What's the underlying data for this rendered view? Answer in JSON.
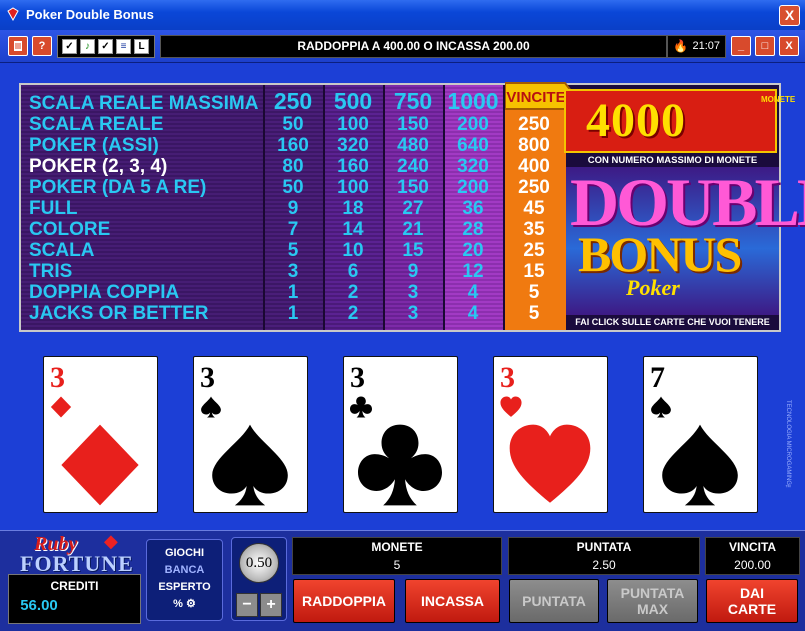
{
  "window": {
    "title": "Poker Double Bonus",
    "close_label": "X"
  },
  "toolbar": {
    "message": "RADDOPPIA A 400.00 O INCASSA 200.00",
    "time": "21:07",
    "help_label": "?",
    "mini_last": "L",
    "minimize": "_",
    "maximize": "□",
    "close": "X"
  },
  "paytable": {
    "vincite_label": "VINCITE",
    "rows": [
      {
        "hand": "SCALA REALE MASSIMA",
        "v": [
          "250",
          "500",
          "750",
          "1000"
        ],
        "win": ""
      },
      {
        "hand": "SCALA REALE",
        "v": [
          "50",
          "100",
          "150",
          "200"
        ],
        "win": "250"
      },
      {
        "hand": "POKER (ASSI)",
        "v": [
          "160",
          "320",
          "480",
          "640"
        ],
        "win": "800"
      },
      {
        "hand": "POKER (2, 3, 4)",
        "v": [
          "80",
          "160",
          "240",
          "320"
        ],
        "win": "400"
      },
      {
        "hand": "POKER (DA 5 A RE)",
        "v": [
          "50",
          "100",
          "150",
          "200"
        ],
        "win": "250"
      },
      {
        "hand": "FULL",
        "v": [
          "9",
          "18",
          "27",
          "36"
        ],
        "win": "45"
      },
      {
        "hand": "COLORE",
        "v": [
          "7",
          "14",
          "21",
          "28"
        ],
        "win": "35"
      },
      {
        "hand": "SCALA",
        "v": [
          "5",
          "10",
          "15",
          "20"
        ],
        "win": "25"
      },
      {
        "hand": "TRIS",
        "v": [
          "3",
          "6",
          "9",
          "12"
        ],
        "win": "15"
      },
      {
        "hand": "DOPPIA COPPIA",
        "v": [
          "1",
          "2",
          "3",
          "4"
        ],
        "win": "5"
      },
      {
        "hand": "JACKS OR BETTER",
        "v": [
          "1",
          "2",
          "3",
          "4"
        ],
        "win": "5"
      }
    ],
    "jackpot": "4000",
    "jackpot_unit": "MONETE",
    "max_coins_note": "CON NUMERO MASSIMO DI MONETE GIOCATE",
    "logo_double": "DOUBLE",
    "logo_bonus": "BONUS",
    "logo_poker": "Poker",
    "click_note": "FAI CLICK SULLE CARTE CHE VUOI TENERE"
  },
  "cards": [
    {
      "rank": "3",
      "suit": "diamond",
      "color": "#e8201c"
    },
    {
      "rank": "3",
      "suit": "spade",
      "color": "#000000"
    },
    {
      "rank": "3",
      "suit": "club",
      "color": "#000000"
    },
    {
      "rank": "3",
      "suit": "heart",
      "color": "#e8201c"
    },
    {
      "rank": "7",
      "suit": "spade",
      "color": "#000000"
    }
  ],
  "copyright": "TECNOLOGIA MICROGAMING™",
  "bottom": {
    "brand_line1": "Ruby",
    "brand_line2": "FORTUNE",
    "credits_label": "CREDITI",
    "credits_value": "56.00",
    "modes": [
      "GIOCHI",
      "BANCA",
      "ESPERTO"
    ],
    "mode_icons": "% ⚙",
    "coin_value": "0.50",
    "minus": "−",
    "plus": "+",
    "monete_label": "MONETE",
    "monete_value": "5",
    "puntata_label": "PUNTATA",
    "puntata_value": "2.50",
    "vincita_label": "VINCITA",
    "vincita_value": "200.00",
    "buttons": {
      "raddoppia": "RADDOPPIA",
      "incassa": "INCASSA",
      "puntata": "PUNTATA",
      "puntata_max_1": "PUNTATA",
      "puntata_max_2": "MAX",
      "dai_carte_1": "DAI",
      "dai_carte_2": "CARTE"
    }
  },
  "colors": {
    "accent_red": "#d81e12",
    "paytable_text": "#29c8f2",
    "win_column": "#f07a10"
  }
}
